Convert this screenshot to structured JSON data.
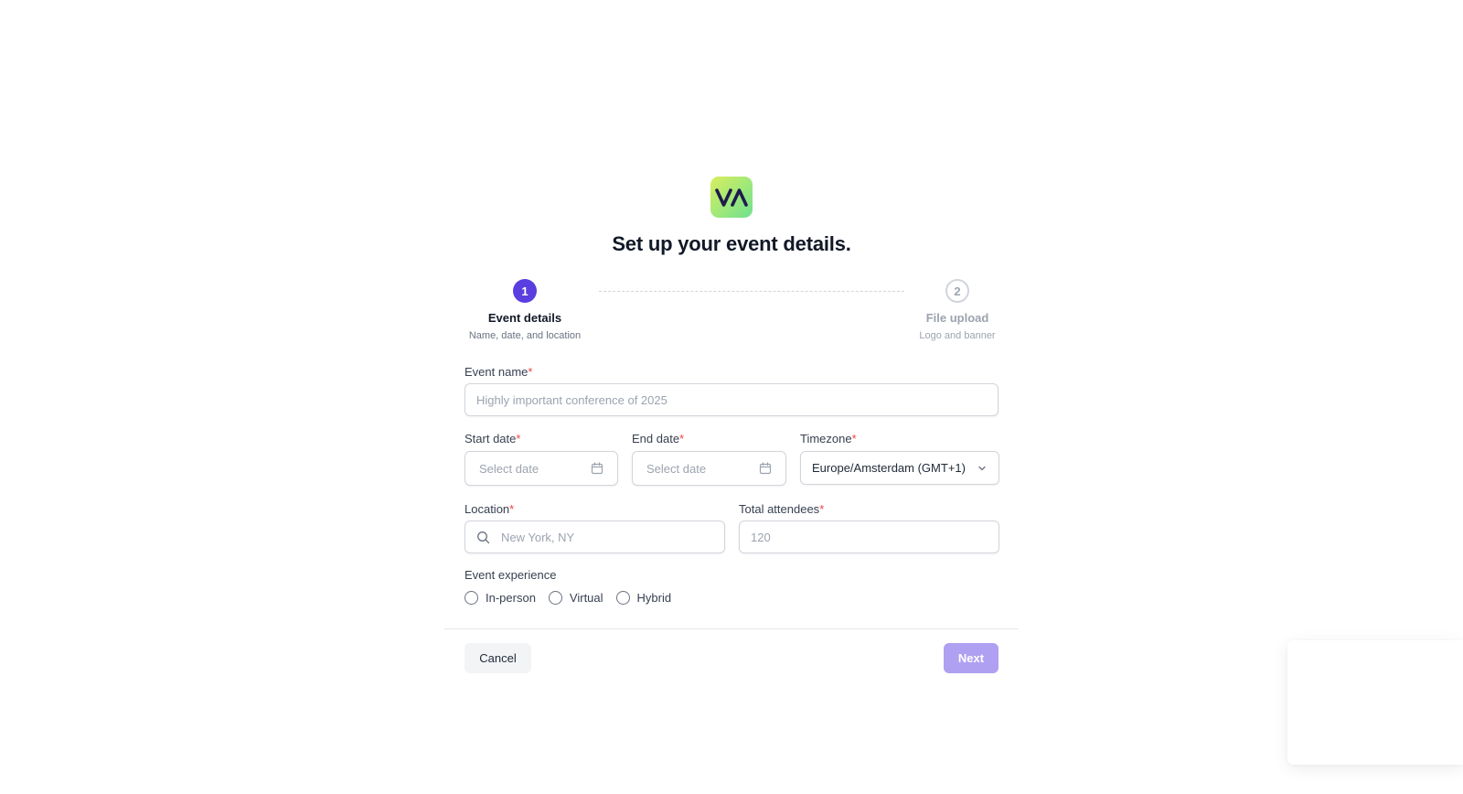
{
  "logo": {
    "text": "VA",
    "gradient": [
      "#d9ee5f",
      "#6fe08f"
    ],
    "text_color": "#1e1b4b"
  },
  "page": {
    "title": "Set up your event details."
  },
  "stepper": {
    "steps": [
      {
        "number": "1",
        "title": "Event details",
        "subtitle": "Name, date, and location",
        "state": "active"
      },
      {
        "number": "2",
        "title": "File upload",
        "subtitle": "Logo and banner",
        "state": "inactive"
      }
    ],
    "active_color": "#5b3ee0"
  },
  "form": {
    "required_marker": "*",
    "event_name": {
      "label": "Event name",
      "placeholder": "Highly important conference of 2025",
      "value": ""
    },
    "start_date": {
      "label": "Start date",
      "placeholder": "Select date",
      "icon": "calendar-icon"
    },
    "end_date": {
      "label": "End date",
      "placeholder": "Select date",
      "icon": "calendar-icon"
    },
    "timezone": {
      "label": "Timezone",
      "value": "Europe/Amsterdam (GMT+1)",
      "icon": "chevron-down-icon"
    },
    "location": {
      "label": "Location",
      "placeholder": "New York, NY",
      "icon": "search-icon"
    },
    "total_attendees": {
      "label": "Total attendees",
      "placeholder": "120"
    },
    "event_experience": {
      "label": "Event experience",
      "options": [
        "In-person",
        "Virtual",
        "Hybrid"
      ],
      "selected": null
    }
  },
  "actions": {
    "cancel_label": "Cancel",
    "next_label": "Next",
    "next_color": "#b0a0f2"
  }
}
